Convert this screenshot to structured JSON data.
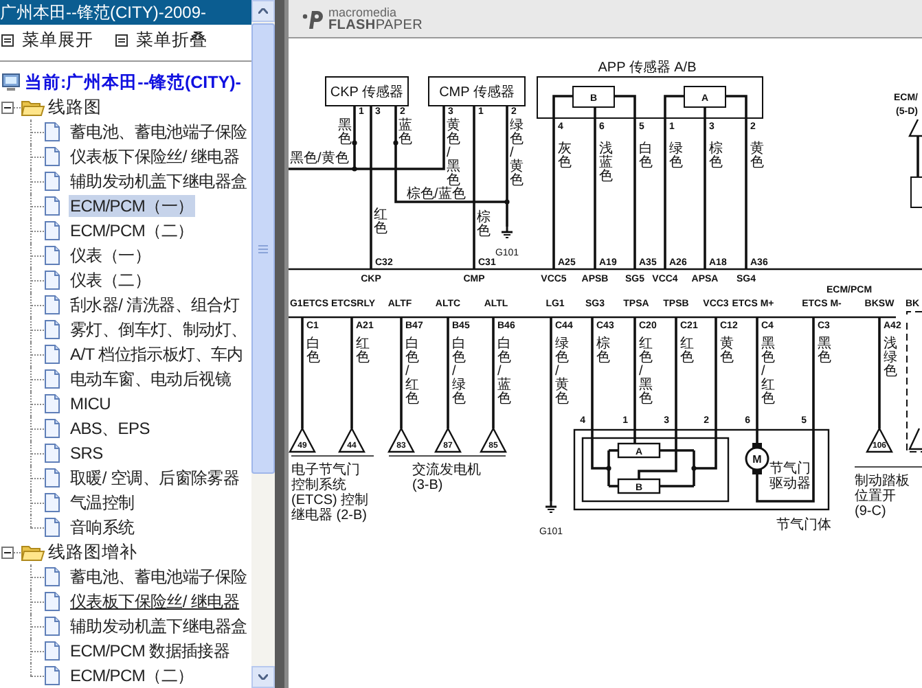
{
  "left_panel": {
    "title": "广州本田--锋范(CITY)-2009-",
    "menu_buttons": [
      {
        "label": "菜单展开"
      },
      {
        "label": "菜单折叠"
      }
    ],
    "tree": {
      "label": "当前:广州本田--锋范(CITY)-",
      "children": [
        {
          "label": "线路图",
          "expanded": true,
          "children": [
            {
              "label": "蓄电池、蓄电池端子保险",
              "selected": false,
              "hovered": false
            },
            {
              "label": "仪表板下保险丝/ 继电器",
              "selected": false,
              "hovered": false
            },
            {
              "label": "辅助发动机盖下继电器盒",
              "selected": false,
              "hovered": false
            },
            {
              "label": "ECM/PCM（一）",
              "selected": true,
              "hovered": false
            },
            {
              "label": "ECM/PCM（二）",
              "selected": false,
              "hovered": false
            },
            {
              "label": "仪表（一）",
              "selected": false,
              "hovered": false
            },
            {
              "label": "仪表（二）",
              "selected": false,
              "hovered": false
            },
            {
              "label": "刮水器/ 清洗器、组合灯",
              "selected": false,
              "hovered": false
            },
            {
              "label": "雾灯、倒车灯、制动灯、",
              "selected": false,
              "hovered": false
            },
            {
              "label": "A/T 档位指示板灯、车内",
              "selected": false,
              "hovered": false
            },
            {
              "label": "电动车窗、电动后视镜",
              "selected": false,
              "hovered": false
            },
            {
              "label": "MICU",
              "selected": false,
              "hovered": false
            },
            {
              "label": "ABS、EPS",
              "selected": false,
              "hovered": false
            },
            {
              "label": "SRS",
              "selected": false,
              "hovered": false
            },
            {
              "label": "取暖/ 空调、后窗除雾器",
              "selected": false,
              "hovered": false
            },
            {
              "label": "气温控制",
              "selected": false,
              "hovered": false
            },
            {
              "label": "音响系统",
              "selected": false,
              "hovered": false
            }
          ]
        },
        {
          "label": "线路图增补",
          "expanded": true,
          "children": [
            {
              "label": "蓄电池、蓄电池端子保险",
              "selected": false,
              "hovered": false
            },
            {
              "label": "仪表板下保险丝/ 继电器",
              "selected": false,
              "hovered": true
            },
            {
              "label": "辅助发动机盖下继电器盒",
              "selected": false,
              "hovered": false
            },
            {
              "label": "ECM/PCM 数据插接器",
              "selected": false,
              "hovered": false
            },
            {
              "label": "ECM/PCM（二）",
              "selected": false,
              "hovered": false
            }
          ]
        }
      ]
    }
  },
  "viewer": {
    "logo": {
      "brand": "macromedia",
      "product": "**FLASH**PAPER"
    },
    "diagram": {
      "sensors": [
        {
          "label": "CKP 传感器",
          "pins": [
            {
              "number": "1",
              "wire": "黑色"
            },
            {
              "number": "3",
              "wire": "红色"
            },
            {
              "number": "2",
              "wire": "蓝色"
            }
          ]
        },
        {
          "label": "CMP 传感器",
          "pins": [
            {
              "number": "3",
              "wire": "黄色/黑色"
            },
            {
              "number": "1",
              "wire": "棕色"
            },
            {
              "number": "2",
              "wire": "绿色/黄色"
            }
          ]
        }
      ],
      "splice_wires": [
        "黑色/黄色",
        "棕色/蓝色"
      ],
      "app_sensor": {
        "label": "APP 传感器 A/B",
        "elements": [
          "B",
          "A"
        ],
        "pins": [
          {
            "number": "4",
            "wire": "灰色"
          },
          {
            "number": "6",
            "wire": "浅蓝色"
          },
          {
            "number": "5",
            "wire": "白色"
          },
          {
            "number": "1",
            "wire": "绿色"
          },
          {
            "number": "3",
            "wire": "棕色"
          },
          {
            "number": "2",
            "wire": "黄色"
          }
        ]
      },
      "upper_terminals": [
        {
          "connector": "C32",
          "terminal": "CKP"
        },
        {
          "connector": "C31",
          "terminal": "CMP"
        },
        {
          "connector": "A25",
          "terminal": "VCC5"
        },
        {
          "connector": "A19",
          "terminal": "APSB"
        },
        {
          "connector": "A35",
          "terminal": "SG5"
        },
        {
          "connector": "A26",
          "terminal": "VCC4"
        },
        {
          "connector": "A18",
          "terminal": "APSA"
        },
        {
          "connector": "A36",
          "terminal": "SG4"
        }
      ],
      "module_label": "ECM/PCM",
      "lower_terminals": [
        {
          "terminal": "G1ETCS",
          "connector": "C1",
          "wire": "白色",
          "ref": "49"
        },
        {
          "terminal": "ETCSRLY",
          "connector": "A21",
          "wire": "红色",
          "ref": "44"
        },
        {
          "terminal": "ALTF",
          "connector": "B47",
          "wire": "白色/红色",
          "ref": "83"
        },
        {
          "terminal": "ALTC",
          "connector": "B45",
          "wire": "白色/绿色",
          "ref": "87"
        },
        {
          "terminal": "ALTL",
          "connector": "B46",
          "wire": "白色/蓝色",
          "ref": "85"
        },
        {
          "terminal": "LG1",
          "connector": "C44",
          "wire": "绿色/黄色"
        },
        {
          "terminal": "SG3",
          "connector": "C43",
          "wire": "棕色"
        },
        {
          "terminal": "TPSA",
          "connector": "C20",
          "wire": "红色/黑色"
        },
        {
          "terminal": "TPSB",
          "connector": "C21",
          "wire": "红色"
        },
        {
          "terminal": "VCC3",
          "connector": "C12",
          "wire": "黄色"
        },
        {
          "terminal": "ETCS M+",
          "connector": "C4",
          "wire": "黑色/红色"
        },
        {
          "terminal": "ETCS M-",
          "connector": "C3",
          "wire": "黑色"
        },
        {
          "terminal": "BKSW",
          "connector": "A42",
          "wire": "浅绿色",
          "ref": "106"
        }
      ],
      "grounds": [
        "G101",
        "G101"
      ],
      "throttle_body": {
        "label": "节气门体",
        "elements": [
          "A",
          "B"
        ],
        "motor": "M",
        "motor_label": [
          "节气门",
          "驱动器"
        ],
        "pins": [
          "4",
          "1",
          "3",
          "2",
          "6",
          "5"
        ]
      },
      "device_notes": [
        {
          "lines": [
            "电子节气门",
            "控制系统",
            "(ETCS) 控制",
            "继电器 (2-B)"
          ]
        },
        {
          "lines": [
            "交流发电机",
            "(3-B)"
          ]
        },
        {
          "lines": [
            "制动踏板",
            "位置开",
            "(9-C)"
          ]
        }
      ],
      "offpage": {
        "upper": {
          "label": "ECM/",
          "ref": "(5-D)"
        },
        "lower": {
          "label": "BK"
        }
      }
    }
  }
}
